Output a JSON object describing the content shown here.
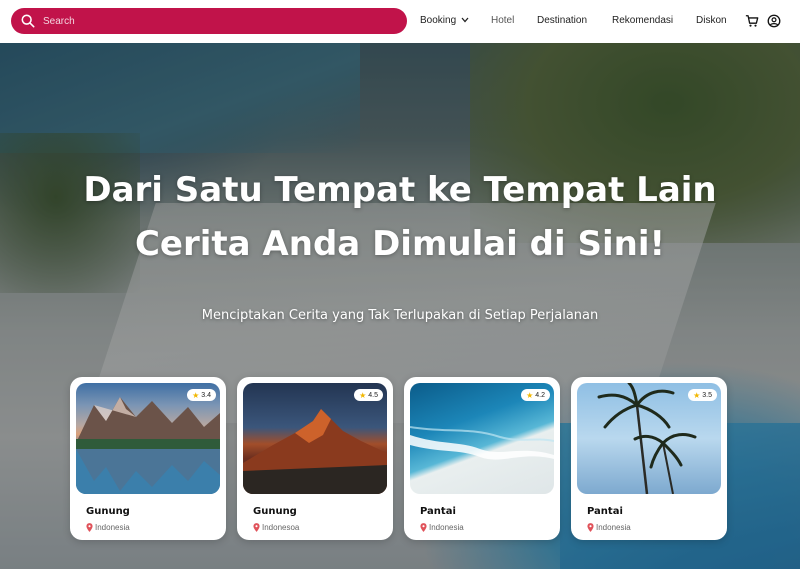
{
  "search": {
    "placeholder": "Search"
  },
  "nav": {
    "booking": "Booking",
    "hotel": "Hotel",
    "destination": "Destination",
    "rekomendasi": "Rekomendasi",
    "diskon": "Diskon"
  },
  "hero": {
    "headline_line1": "Dari Satu Tempat ke Tempat Lain",
    "headline_line2": "Cerita Anda Dimulai di Sini!",
    "subline": "Menciptakan Cerita yang Tak Terlupakan di Setiap Perjalanan"
  },
  "cards": [
    {
      "title": "Gunung",
      "location": "Indonesia",
      "rating": "3.4"
    },
    {
      "title": "Gunung",
      "location": "Indonesoa",
      "rating": "4.5"
    },
    {
      "title": "Pantai",
      "location": "Indonesia",
      "rating": "4.2"
    },
    {
      "title": "Pantai",
      "location": "Indonesia",
      "rating": "3.5"
    }
  ],
  "colors": {
    "accent": "#c1134a",
    "star": "#f2b700"
  }
}
